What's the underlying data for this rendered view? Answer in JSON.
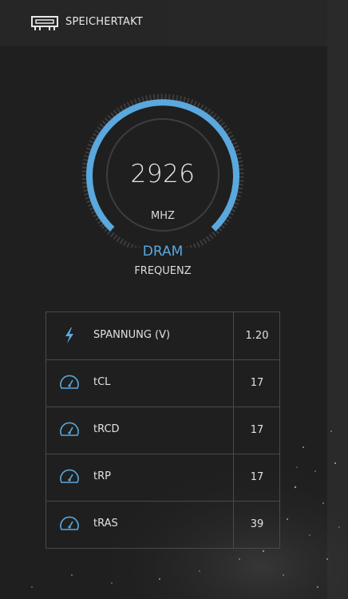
{
  "header": {
    "title": "SPEICHERTAKT",
    "icon": "memory-module-icon"
  },
  "gauge": {
    "value": "2926",
    "unit": "MHZ",
    "label": "DRAM",
    "sublabel": "FREQUENZ",
    "arc_color": "#5aa8de"
  },
  "table": {
    "rows": [
      {
        "icon": "lightning-icon",
        "label": "SPANNUNG (V)",
        "value": "1.20"
      },
      {
        "icon": "speedometer-icon",
        "label": "tCL",
        "value": "17"
      },
      {
        "icon": "speedometer-icon",
        "label": "tRCD",
        "value": "17"
      },
      {
        "icon": "speedometer-icon",
        "label": "tRP",
        "value": "17"
      },
      {
        "icon": "speedometer-icon",
        "label": "tRAS",
        "value": "39"
      }
    ]
  },
  "colors": {
    "accent": "#5aa8de",
    "background": "#1f1f1f",
    "border": "#4a4a4a"
  }
}
